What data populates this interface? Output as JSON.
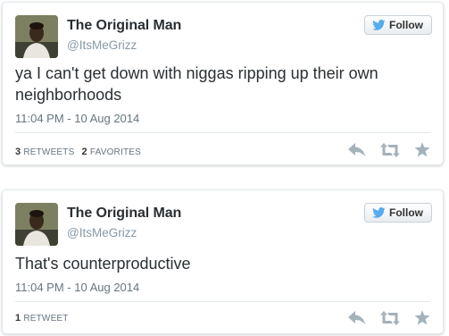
{
  "tweets": [
    {
      "display_name": "The Original Man",
      "screen_name": "@ItsMeGrizz",
      "follow_label": "Follow",
      "text": "ya I can't get down with niggas ripping up their own neighborhoods",
      "timestamp": "11:04 PM - 10 Aug 2014",
      "retweets_count": "3",
      "retweets_label": "Retweets",
      "favorites_count": "2",
      "favorites_label": "Favorites"
    },
    {
      "display_name": "The Original Man",
      "screen_name": "@ItsMeGrizz",
      "follow_label": "Follow",
      "text": "That's counterproductive",
      "timestamp": "11:04 PM - 10 Aug 2014",
      "retweets_count": "1",
      "retweets_label": "Retweet"
    }
  ],
  "icons": {
    "follow": "twitter-bird-icon",
    "reply": "reply-icon",
    "retweet": "retweet-icon",
    "favorite": "star-icon"
  },
  "colors": {
    "bird_blue": "#55acee",
    "action_gray": "#a4b2bb",
    "name_text": "#292f33",
    "meta_text": "#8899a6"
  }
}
